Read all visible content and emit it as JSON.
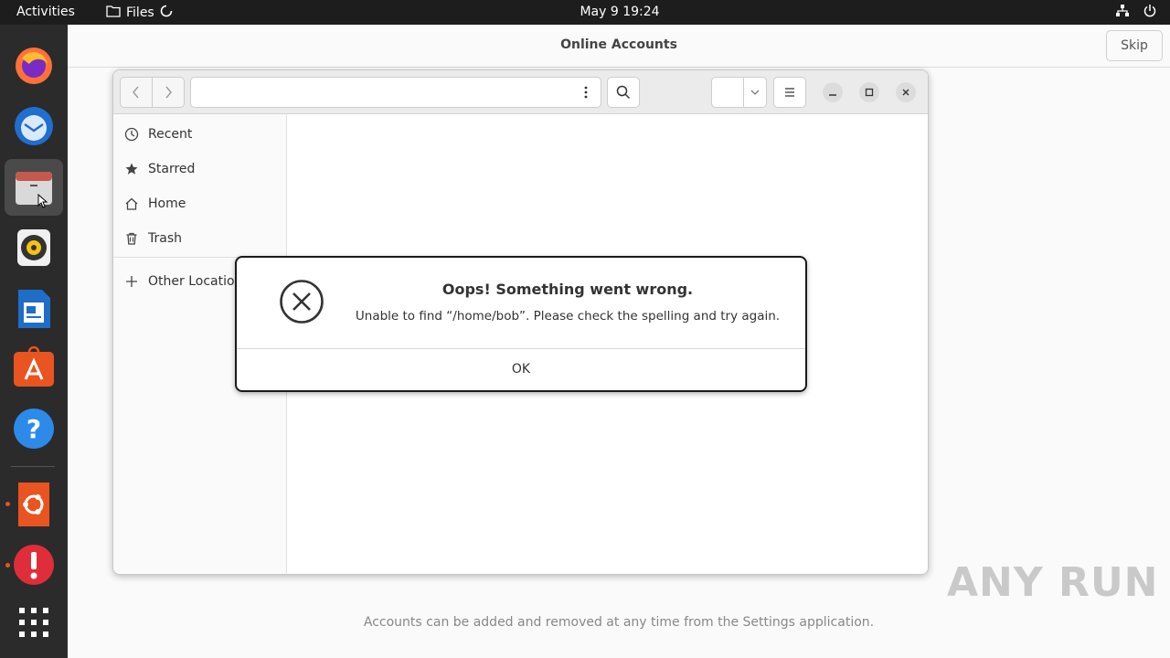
{
  "topbar": {
    "activities": "Activities",
    "app_name": "Files",
    "clock": "May 9  19:24"
  },
  "dock": {
    "items": [
      "firefox-icon",
      "thunderbird-icon",
      "files-icon",
      "rhythmbox-icon",
      "writer-icon",
      "software-icon",
      "help-icon",
      "ubuntu-icon",
      "error-report-icon",
      "show-apps-icon"
    ]
  },
  "online_accounts": {
    "title": "Online Accounts",
    "skip_label": "Skip",
    "footer": "Accounts can be added and removed at any time from the Settings application."
  },
  "files": {
    "sidebar": {
      "items": [
        {
          "label": "Recent",
          "icon": "clock-icon"
        },
        {
          "label": "Starred",
          "icon": "star-icon"
        },
        {
          "label": "Home",
          "icon": "home-icon"
        },
        {
          "label": "Trash",
          "icon": "trash-icon"
        },
        {
          "label": "Other Locations",
          "icon": "plus-icon"
        }
      ]
    }
  },
  "dialog": {
    "title": "Oops! Something went wrong.",
    "message": "Unable to find “/home/bob”. Please check the spelling and try again.",
    "ok_label": "OK"
  },
  "watermark": "ANY RUN",
  "colors": {
    "accent": "#e95420",
    "topbar": "#1d1d1d",
    "dock": "#2b2b2b"
  }
}
